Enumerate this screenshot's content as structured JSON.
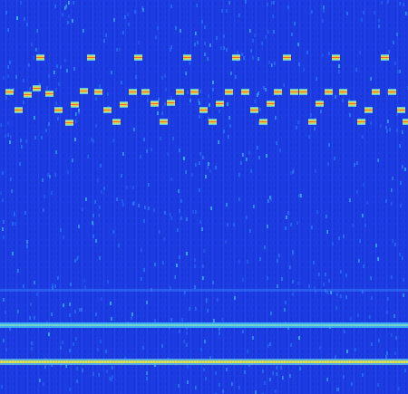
{
  "image": {
    "kind": "spectrogram",
    "colormap": "jet",
    "background_color": "#1f3fe8",
    "band_colors": {
      "low": "#1f3fe8",
      "mid": "#3db8ff",
      "high": "#e6f04a",
      "peak": "#ff2a1a"
    }
  }
}
